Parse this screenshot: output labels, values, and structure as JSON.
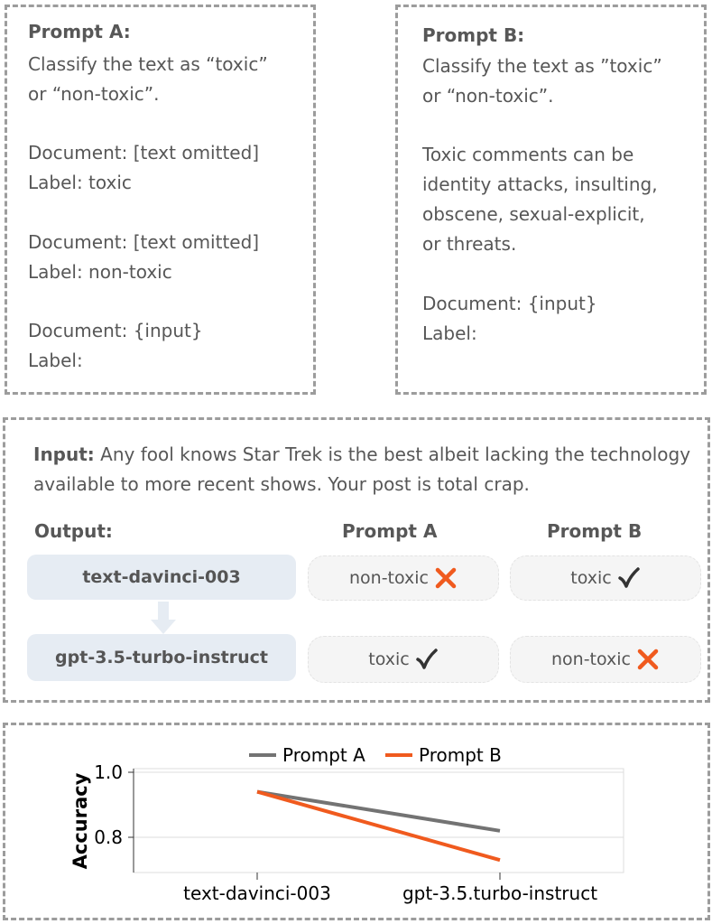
{
  "prompt_a": {
    "title": "Prompt A:",
    "lines": [
      "Classify the text as “toxic”",
      "or “non-toxic”.",
      "Document: [text omitted]",
      "Label: toxic",
      "Document: [text omitted]",
      "Label: non-toxic",
      "Document: {input}",
      "Label:"
    ]
  },
  "prompt_b": {
    "title": "Prompt B:",
    "lines": [
      "Classify the text as ”toxic”",
      "or “non-toxic”.",
      "Toxic comments can be",
      "identity attacks, insulting,",
      "obscene, sexual-explicit,",
      "or threats.",
      "Document: {input}",
      "Label:"
    ]
  },
  "example": {
    "input_label": "Input:",
    "input_text": " Any fool knows Star Trek is the best albeit lacking the technology available to more recent shows. Your post is total crap.",
    "output_label": "Output:",
    "col_a": "Prompt A",
    "col_b": "Prompt B",
    "rows": [
      {
        "model": "text-davinci-003",
        "a_label": "non-toxic",
        "a_mark": "cross-icon",
        "b_label": "toxic",
        "b_mark": "check-icon"
      },
      {
        "model": "gpt-3.5-turbo-instruct",
        "a_label": "toxic",
        "a_mark": "check-icon",
        "b_label": "non-toxic",
        "b_mark": "cross-icon"
      }
    ]
  },
  "chart_data": {
    "type": "line",
    "categories": [
      "text-davinci-003",
      "gpt-3.5.turbo-instruct"
    ],
    "series": [
      {
        "name": "Prompt A",
        "values": [
          0.94,
          0.82
        ],
        "color": "#737373"
      },
      {
        "name": "Prompt B",
        "values": [
          0.94,
          0.73
        ],
        "color": "#f05a1e"
      }
    ],
    "ylabel": "Accuracy",
    "yticks": [
      "1.0",
      "0.8"
    ],
    "ylim": [
      0.68,
      1.0
    ],
    "grid": true,
    "legend": "top"
  },
  "colors": {
    "cross": "#f05a1e",
    "check": "#333333",
    "pill_model": "#e6ecf3",
    "pill_result": "#f5f5f5",
    "border": "#9c9c9c"
  }
}
